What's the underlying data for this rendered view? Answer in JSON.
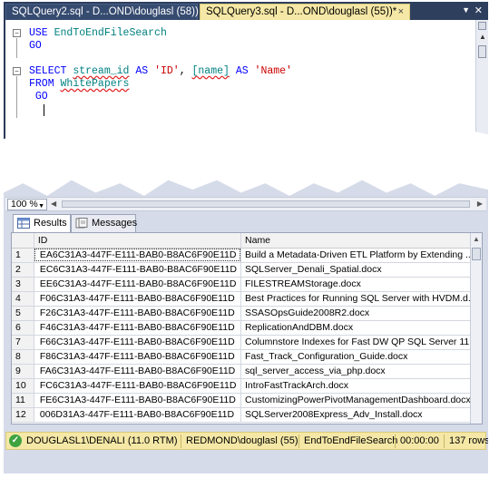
{
  "editor": {
    "tabs": [
      {
        "label": "SQLQuery2.sql - D...OND\\douglasl (58))",
        "active": false
      },
      {
        "label": "SQLQuery3.sql - D...OND\\douglasl (55))*",
        "active": true
      }
    ],
    "tab_close": "×",
    "lines": {
      "l1_kw": "USE",
      "l1_id": "EndToEndFileSearch",
      "l2_kw": "GO",
      "l4_kw1": "SELECT",
      "l4_id1": "stream_id",
      "l4_kw2": "AS",
      "l4_str1": "'ID'",
      "l4_sep": ",",
      "l4_id2": "[name]",
      "l4_kw3": "AS",
      "l4_str2": "'Name'",
      "l5_kw": "FROM",
      "l5_id": "WhitePapers",
      "l6_kw": "GO"
    }
  },
  "results": {
    "zoom": "100 %",
    "tabs": [
      {
        "label": "Results",
        "icon": "grid-icon"
      },
      {
        "label": "Messages",
        "icon": "messages-icon"
      }
    ],
    "columns": [
      "",
      "ID",
      "Name"
    ],
    "rows": [
      [
        "1",
        "EA6C31A3-447F-E111-BAB0-B8AC6F90E11D",
        "Build a Metadata-Driven ETL Platform by Extending ..."
      ],
      [
        "2",
        "EC6C31A3-447F-E111-BAB0-B8AC6F90E11D",
        "SQLServer_Denali_Spatial.docx"
      ],
      [
        "3",
        "EE6C31A3-447F-E111-BAB0-B8AC6F90E11D",
        "FILESTREAMStorage.docx"
      ],
      [
        "4",
        "F06C31A3-447F-E111-BAB0-B8AC6F90E11D",
        "Best Practices for Running SQL Server with HVDM.d..."
      ],
      [
        "5",
        "F26C31A3-447F-E111-BAB0-B8AC6F90E11D",
        "SSASOpsGuide2008R2.docx"
      ],
      [
        "6",
        "F46C31A3-447F-E111-BAB0-B8AC6F90E11D",
        "ReplicationAndDBM.docx"
      ],
      [
        "7",
        "F66C31A3-447F-E111-BAB0-B8AC6F90E11D",
        "Columnstore Indexes for Fast DW QP SQL Server 11..."
      ],
      [
        "8",
        "F86C31A3-447F-E111-BAB0-B8AC6F90E11D",
        "Fast_Track_Configuration_Guide.docx"
      ],
      [
        "9",
        "FA6C31A3-447F-E111-BAB0-B8AC6F90E11D",
        "sql_server_access_via_php.docx"
      ],
      [
        "10",
        "FC6C31A3-447F-E111-BAB0-B8AC6F90E11D",
        "IntroFastTrackArch.docx"
      ],
      [
        "11",
        "FE6C31A3-447F-E111-BAB0-B8AC6F90E11D",
        "CustomizingPowerPivotManagementDashboard.docx"
      ],
      [
        "12",
        "006D31A3-447F-E111-BAB0-B8AC6F90E11D",
        "SQLServer2008Express_Adv_Install.docx"
      ]
    ]
  },
  "status": {
    "server": "DOUGLASL1\\DENALI (11.0 RTM)",
    "user": "REDMOND\\douglasl (55)",
    "database": "EndToEndFileSearch",
    "elapsed": "00:00:00",
    "rows": "137 rows"
  },
  "colors": {
    "tab_active": "#f5e8a6",
    "chrome_dark": "#2b3a58",
    "keyword": "#0000ff",
    "string": "#cc0000",
    "identifier": "#008080",
    "status_ok": "#3fa33f"
  }
}
